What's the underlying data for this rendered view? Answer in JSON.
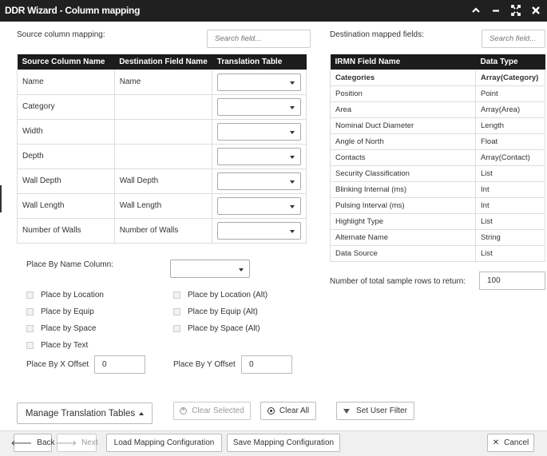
{
  "window": {
    "title": "DDR Wizard - Column mapping",
    "icons": [
      "chevron-up-icon",
      "minimize-icon",
      "expand-icon",
      "close-icon"
    ]
  },
  "source": {
    "label": "Source column mapping:",
    "search_placeholder": "Search field...",
    "headers": [
      "Source Column Name",
      "Destination Field Name",
      "Translation Table"
    ],
    "rows": [
      {
        "source": "Name",
        "destination": "Name",
        "translation": ""
      },
      {
        "source": "Category",
        "destination": "",
        "translation": ""
      },
      {
        "source": "Width",
        "destination": "",
        "translation": ""
      },
      {
        "source": "Depth",
        "destination": "",
        "translation": ""
      },
      {
        "source": "Wall Depth",
        "destination": "Wall Depth",
        "translation": ""
      },
      {
        "source": "Wall Length",
        "destination": "Wall Length",
        "translation": ""
      },
      {
        "source": "Number of Walls",
        "destination": "Number of Walls",
        "translation": ""
      }
    ]
  },
  "destination": {
    "label": "Destination mapped fields:",
    "search_placeholder": "Search field...",
    "headers": [
      "IRMN Field Name",
      "Data Type"
    ],
    "rows": [
      {
        "field": "Categories",
        "type": "Array(Category)",
        "bold": true
      },
      {
        "field": "Position",
        "type": "Point"
      },
      {
        "field": "Area",
        "type": "Array(Area)"
      },
      {
        "field": "Nominal Duct Diameter",
        "type": "Length"
      },
      {
        "field": "Angle of North",
        "type": "Float"
      },
      {
        "field": "Contacts",
        "type": "Array(Contact)"
      },
      {
        "field": "Security Classification",
        "type": "List"
      },
      {
        "field": "Blinking Internal (ms)",
        "type": "Int"
      },
      {
        "field": "Pulsing Interval (ms)",
        "type": "Int"
      },
      {
        "field": "Highlight Type",
        "type": "List"
      },
      {
        "field": "Alternate Name",
        "type": "String"
      },
      {
        "field": "Data Source",
        "type": "List"
      }
    ],
    "sample_rows_label": "Number of total sample rows to return:",
    "sample_rows_value": "100"
  },
  "placement": {
    "name_column_label": "Place By Name Column:",
    "name_column_value": "",
    "checkboxes_left": [
      "Place by Location",
      "Place by Equip",
      "Place by Space",
      "Place by Text"
    ],
    "checkboxes_right": [
      "Place by Location (Alt)",
      "Place by Equip (Alt)",
      "Place by Space (Alt)"
    ],
    "x_offset_label": "Place By X Offset",
    "x_offset_value": "0",
    "y_offset_label": "Place By Y Offset",
    "y_offset_value": "0"
  },
  "actions": {
    "manage_tables": "Manage Translation Tables",
    "clear_selected": "Clear Selected",
    "clear_all": "Clear All",
    "set_user_filter": "Set User Filter"
  },
  "footer": {
    "back": "Back",
    "next": "Next",
    "load_config": "Load Mapping Configuration",
    "save_config": "Save Mapping Configuration",
    "cancel": "Cancel"
  }
}
